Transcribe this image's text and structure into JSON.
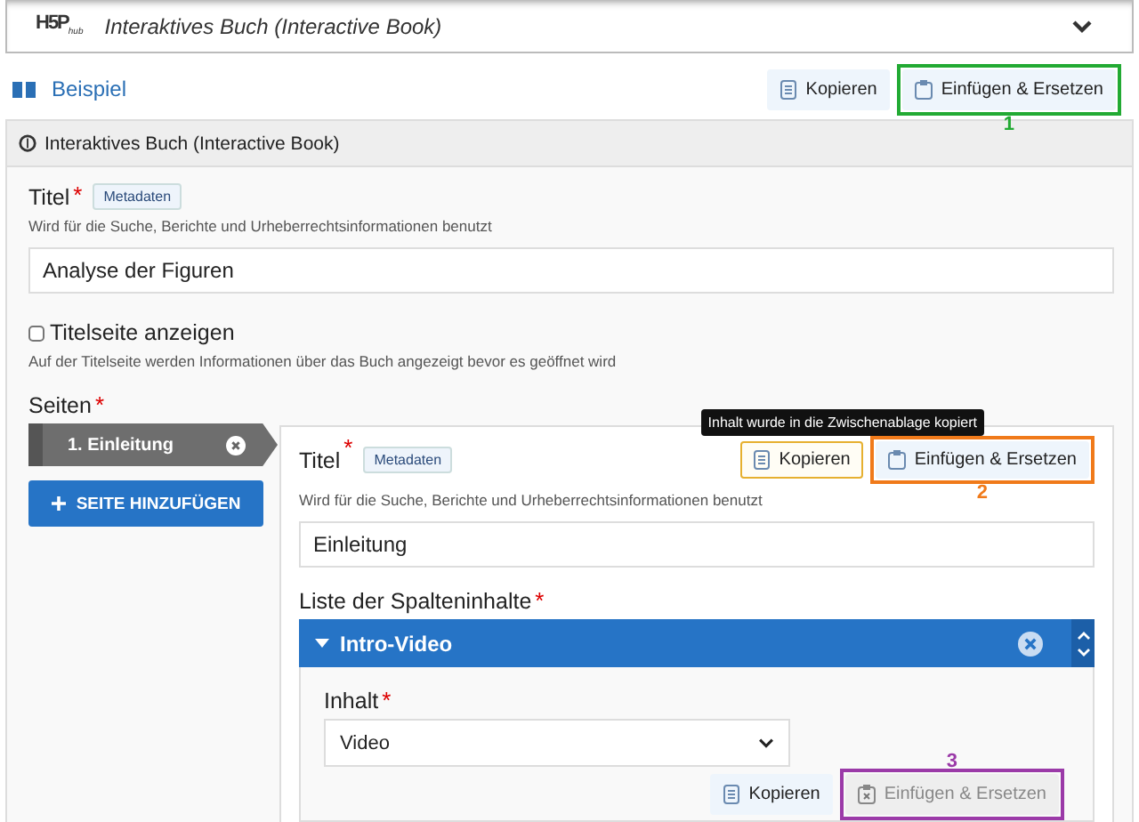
{
  "header": {
    "logo": "H5P",
    "logo_sub": "hub",
    "title": "Interaktives Buch (Interactive Book)"
  },
  "toolbar": {
    "link": "Beispiel",
    "buttons": [
      {
        "label": "Kopieren",
        "kind": "copy",
        "disabled": false,
        "focused": false
      },
      {
        "label": "Einfügen & Ersetzen",
        "kind": "paste",
        "disabled": false,
        "focused": false,
        "highlight": {
          "number": "1",
          "color": "#22aa33"
        }
      }
    ]
  },
  "panel": {
    "title": "Interaktives Buch (Interactive Book)",
    "title_field": {
      "label": "Titel",
      "required_mark": "*",
      "tag": "Metadaten",
      "description": "Wird für die Suche, Berichte und Urheberrechtsinformationen benutzt",
      "value": "Analyse der Figuren"
    },
    "cover": {
      "label": "Titelseite anzeigen",
      "checked": false,
      "description": "Auf der Titelseite werden Informationen über das Buch angezeigt bevor es geöffnet wird"
    },
    "pages": {
      "label": "Seiten",
      "required_mark": "*",
      "items": [
        {
          "label": "1. Einleitung",
          "selected": true
        }
      ],
      "add_button": "SEITE HINZUFÜGEN",
      "editor": {
        "title_field": {
          "label": "Titel",
          "required_mark": "*",
          "tag": "Metadaten",
          "description": "Wird für die Suche, Berichte und Urheberrechtsinformationen benutzt",
          "value": "Einleitung"
        },
        "tooltip": "Inhalt wurde in die Zwischenablage kopiert",
        "buttons": [
          {
            "label": "Kopieren",
            "kind": "copy",
            "disabled": false,
            "focused": true
          },
          {
            "label": "Einfügen & Ersetzen",
            "kind": "paste",
            "disabled": false,
            "focused": false,
            "highlight": {
              "number": "2",
              "color": "#f07a1a"
            }
          }
        ],
        "list": {
          "label": "Liste der Spalteninhalte",
          "required_mark": "*",
          "items": [
            {
              "title": "Intro-Video",
              "expanded": true,
              "content": {
                "label": "Inhalt",
                "required_mark": "*",
                "value": "Video"
              },
              "buttons": [
                {
                  "label": "Kopieren",
                  "kind": "copy",
                  "disabled": false,
                  "focused": false
                },
                {
                  "label": "Einfügen & Ersetzen",
                  "kind": "paste",
                  "disabled": true,
                  "focused": false,
                  "highlight": {
                    "number": "3",
                    "color": "#9b3aa8"
                  }
                }
              ]
            }
          ]
        }
      }
    }
  }
}
